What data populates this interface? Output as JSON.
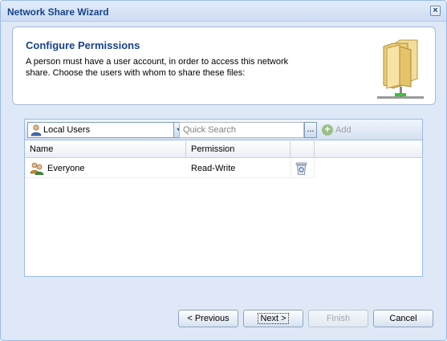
{
  "window": {
    "title": "Network Share Wizard",
    "close_label": "×"
  },
  "header": {
    "title": "Configure Permissions",
    "description": "A person must have a user account, in order to access this network share. Choose the users with whom to share these files:",
    "icon": "folder-share-icon"
  },
  "toolbar": {
    "user_source": "Local Users",
    "search_placeholder": "Quick Search",
    "search_trigger": "...",
    "add_label": "Add",
    "add_enabled": false
  },
  "grid": {
    "columns": [
      "Name",
      "Permission"
    ],
    "rows": [
      {
        "name": "Everyone",
        "permission": "Read-Write",
        "icon": "user-group-icon",
        "action_icon": "delete-icon"
      }
    ]
  },
  "buttons": {
    "previous": "< Previous",
    "next": "Next >",
    "finish": "Finish",
    "cancel": "Cancel"
  },
  "colors": {
    "accent": "#15428b",
    "window_bg": "#dfe8f6",
    "border": "#99bbe8"
  }
}
